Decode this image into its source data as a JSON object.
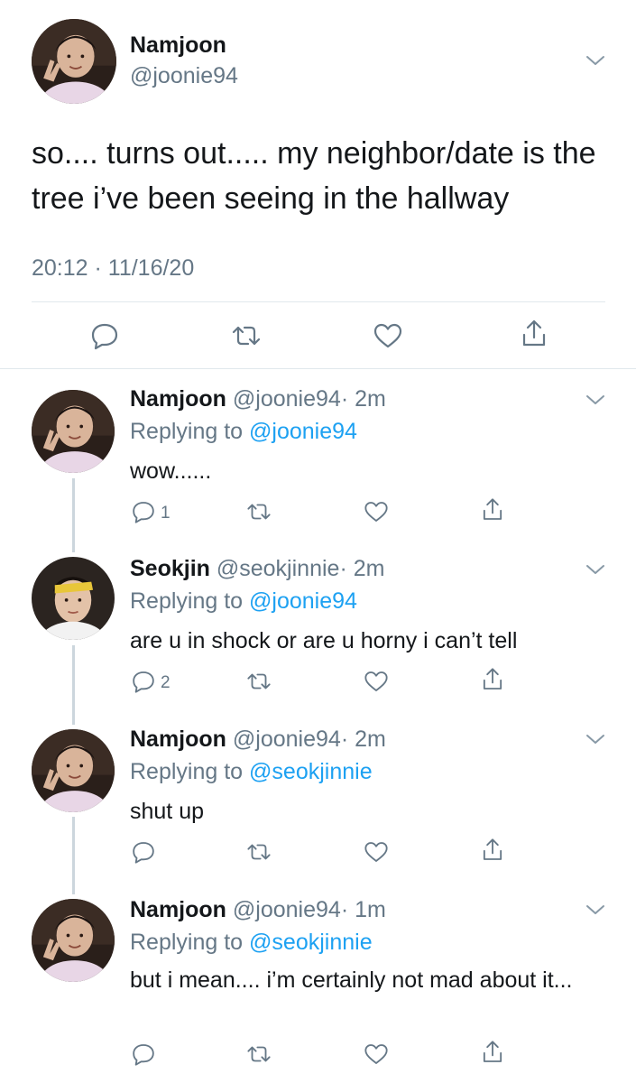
{
  "main_tweet": {
    "name": "Namjoon",
    "handle": "@joonie94",
    "text": "so.... turns out..... my neighbor/date is the tree i’ve been seeing in the hallway",
    "timestamp": "20:12 · 11/16/20",
    "actions": [
      "reply-icon",
      "retweet-icon",
      "like-icon",
      "share-icon"
    ]
  },
  "replies": [
    {
      "name": "Namjoon",
      "handle": "@joonie94",
      "time": "· 2m",
      "replying_prefix": "Replying to",
      "replying_to": "@joonie94",
      "text": "wow......",
      "reply_count": "1"
    },
    {
      "name": "Seokjin",
      "handle": "@seokjinnie",
      "time": "· 2m",
      "replying_prefix": "Replying to",
      "replying_to": "@joonie94",
      "text": "are u in shock or are u horny i can’t tell",
      "reply_count": "2"
    },
    {
      "name": "Namjoon",
      "handle": "@joonie94",
      "time": "· 2m",
      "replying_prefix": "Replying to",
      "replying_to": "@seokjinnie",
      "text": "shut up",
      "reply_count": ""
    },
    {
      "name": "Namjoon",
      "handle": "@joonie94",
      "time": "· 1m",
      "replying_prefix": "Replying to",
      "replying_to": "@seokjinnie",
      "text": "but i mean.... i’m certainly not mad about it...",
      "reply_count": ""
    }
  ],
  "colors": {
    "text": "#14171a",
    "secondary": "#657786",
    "link": "#1da1f2",
    "divider": "#e1e8ed",
    "thread_line": "#ccd6dd"
  }
}
